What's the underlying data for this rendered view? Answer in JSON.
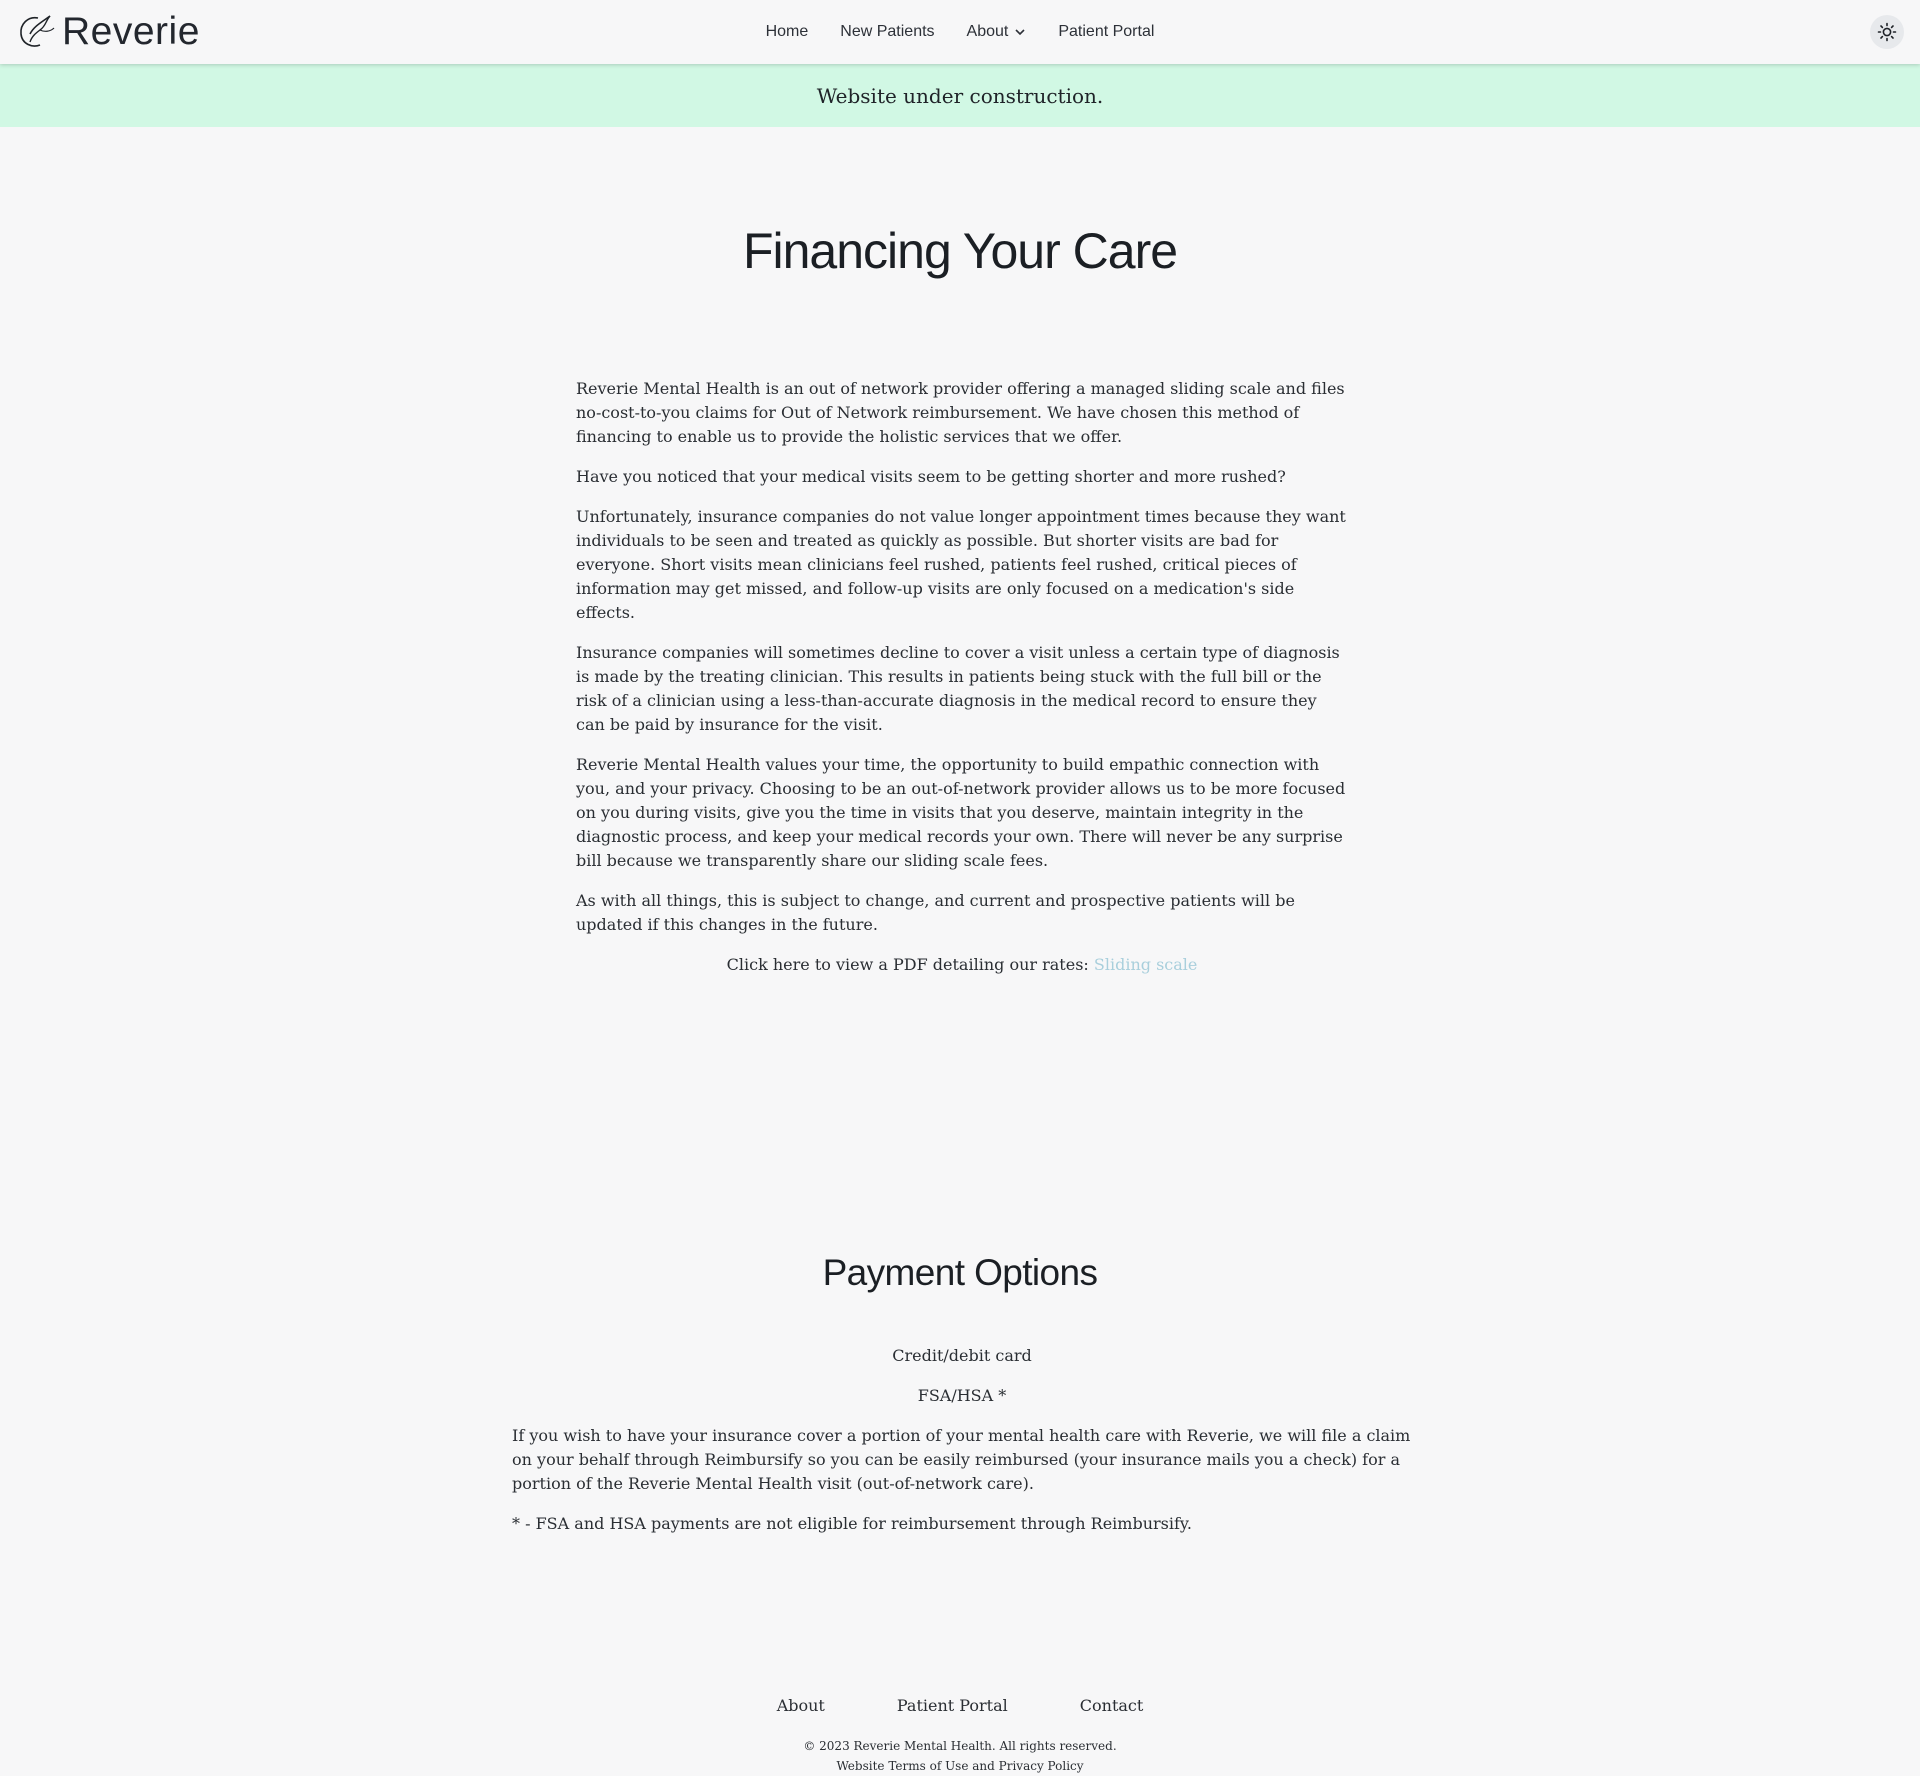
{
  "header": {
    "logo_text": "Reverie",
    "nav": [
      {
        "label": "Home"
      },
      {
        "label": "New Patients"
      },
      {
        "label": "About"
      },
      {
        "label": "Patient Portal"
      }
    ],
    "theme_toggle_icon": "sun-icon"
  },
  "banner": {
    "text": "Website under construction.",
    "color": "#d1f8e4"
  },
  "main": {
    "title": "Financing Your Care",
    "paragraphs": [
      "Reverie Mental Health is an out of network provider offering a managed sliding scale and files no-cost-to-you claims for Out of Network reimbursement. We have chosen this method of financing to enable us to provide the holistic services that we offer.",
      "Have you noticed that your medical visits seem to be getting shorter and more rushed?",
      "Unfortunately, insurance companies do not value longer appointment times because they want individuals to be seen and treated as quickly as possible. But shorter visits are bad for everyone. Short visits mean clinicians feel rushed, patients feel rushed, critical pieces of information may get missed, and follow-up visits are only focused on a medication's side effects.",
      "Insurance companies will sometimes decline to cover a visit unless a certain type of diagnosis is made by the treating clinician. This results in patients being stuck with the full bill or the risk of a clinician using a less-than-accurate diagnosis in the medical record to ensure they can be paid by insurance for the visit.",
      "Reverie Mental Health values your time, the opportunity to build empathic connection with you, and your privacy. Choosing to be an out-of-network provider allows us to be more focused on you during visits, give you the time in visits that you deserve, maintain integrity in the diagnostic process, and keep your medical records your own. There will never be any surprise bill because we transparently share our sliding scale fees.",
      "As with all things, this is subject to change, and current and prospective patients will be updated if this changes in the future."
    ],
    "pdf_prompt": "Click here to view a PDF detailing our rates: ",
    "pdf_link": "Sliding scale",
    "link_color": "#a9cfdc"
  },
  "payment": {
    "title": "Payment Options",
    "option_card": "Credit/debit card",
    "option_fsa": "FSA/HSA *",
    "insurance_text": "If you wish to have your insurance cover a portion of your mental health care with Reverie, we will file a claim on your behalf through Reimbursify so you can be easily reimbursed (your insurance mails you a check) for a portion of the Reverie Mental Health visit (out-of-network care).",
    "footnote": "* - FSA and HSA payments are not eligible for reimbursement through Reimbursify."
  },
  "footer": {
    "links": [
      {
        "label": "About"
      },
      {
        "label": "Patient Portal"
      },
      {
        "label": "Contact"
      }
    ],
    "copyright": "© 2023 Reverie Mental Health. All rights reserved.",
    "terms_link": "Website Terms of Use",
    "terms_joiner": " and ",
    "privacy_link": "Privacy Policy"
  }
}
